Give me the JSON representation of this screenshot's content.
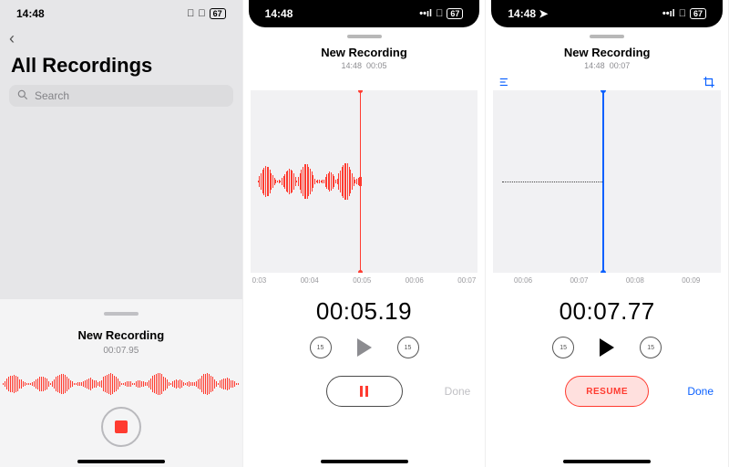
{
  "status": {
    "time": "14:48",
    "battery": "67"
  },
  "pane1": {
    "title": "All Recordings",
    "search_placeholder": "Search",
    "card_title": "New Recording",
    "card_time": "00:07.95"
  },
  "pane2": {
    "title": "New Recording",
    "sub_time": "14:48",
    "sub_dur": "00:05",
    "axis": [
      "0:03",
      "00:04",
      "00:05",
      "00:06",
      "00:07"
    ],
    "big_time": "00:05.19",
    "skip": "15",
    "done": "Done",
    "playhead_pct": 48
  },
  "pane3": {
    "title": "New Recording",
    "sub_time": "14:48",
    "sub_dur": "00:07",
    "axis": [
      "00:06",
      "00:07",
      "00:08",
      "00:09"
    ],
    "big_time": "00:07.77",
    "skip": "15",
    "resume": "RESUME",
    "done": "Done",
    "playhead_pct": 48
  }
}
